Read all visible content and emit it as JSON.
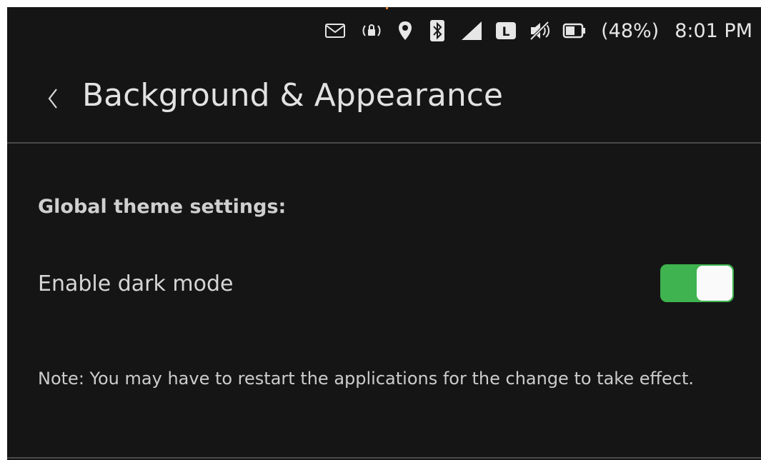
{
  "status_bar": {
    "icons": [
      "mail-icon",
      "rotation-lock-icon",
      "location-icon",
      "bluetooth-icon",
      "signal-icon",
      "lte-icon",
      "muted-speaker-icon",
      "battery-icon"
    ],
    "network_label": "L",
    "battery_percent_text": "(48%)",
    "time": "8:01 PM"
  },
  "header": {
    "back_icon": "chevron-left-icon",
    "title": "Background & Appearance"
  },
  "content": {
    "section_title": "Global theme settings:",
    "dark_mode": {
      "label": "Enable dark mode",
      "enabled": true
    },
    "note": "Note: You may have to restart the applications for the change to take effect."
  },
  "colors": {
    "background": "#151515",
    "toggle_on": "#3eb34f",
    "divider": "#4a4a4a"
  }
}
